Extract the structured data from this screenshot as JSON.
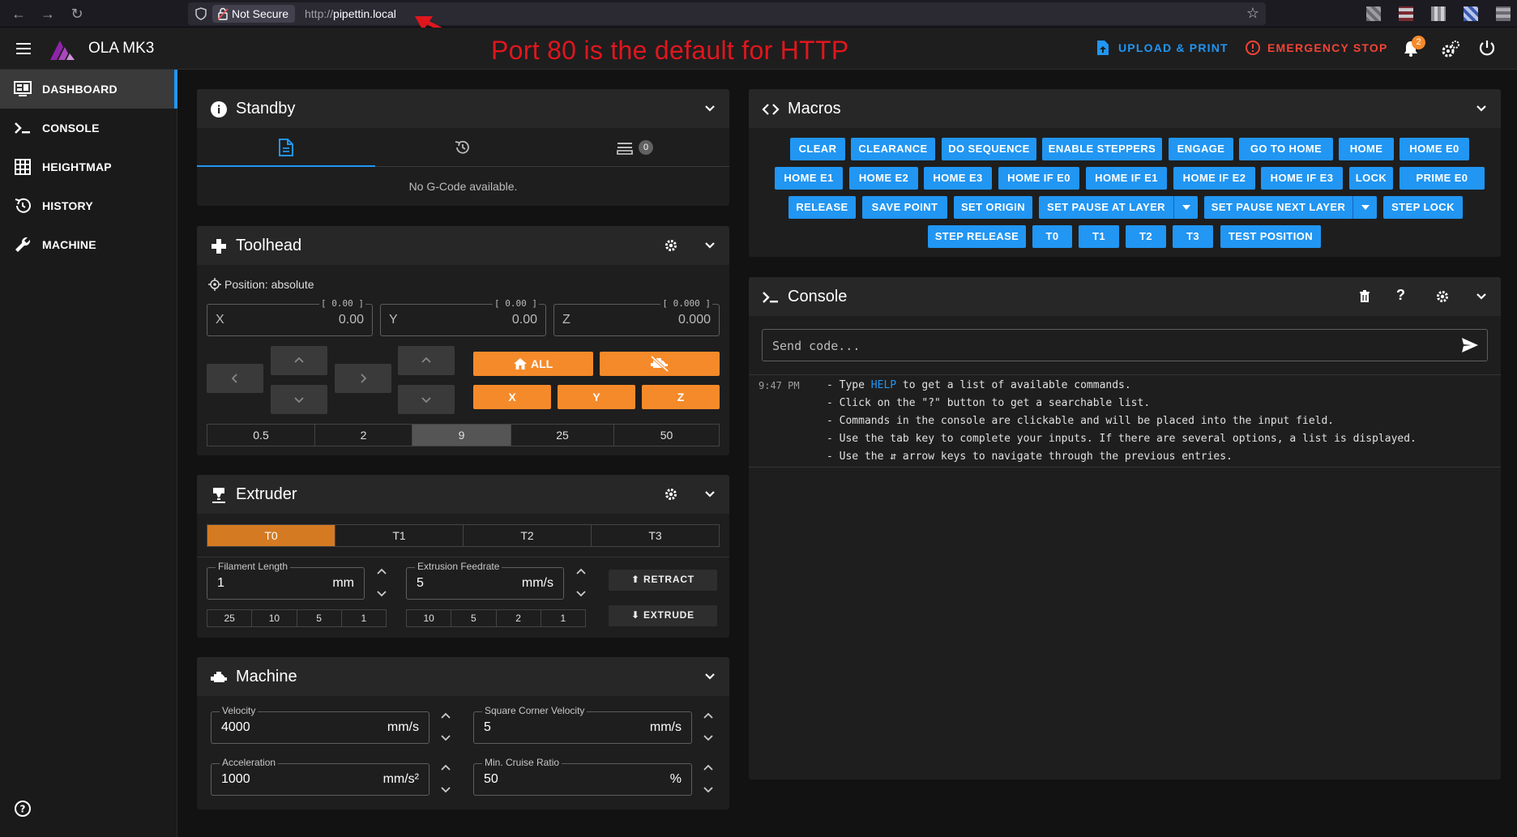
{
  "browser": {
    "not_secure": "Not Secure",
    "url_protocol": "http://",
    "url_host": "pipettin.local"
  },
  "annotation": "Port 80 is the default for HTTP",
  "appbar": {
    "title": "OLA MK3",
    "upload_print": "UPLOAD & PRINT",
    "emergency_stop": "EMERGENCY STOP",
    "notification_count": "2"
  },
  "sidebar": {
    "items": [
      {
        "label": "DASHBOARD",
        "icon": "monitor-dashboard-icon",
        "active": true
      },
      {
        "label": "CONSOLE",
        "icon": "console-icon"
      },
      {
        "label": "HEIGHTMAP",
        "icon": "grid-icon"
      },
      {
        "label": "HISTORY",
        "icon": "history-icon"
      },
      {
        "label": "MACHINE",
        "icon": "wrench-icon"
      }
    ]
  },
  "standby": {
    "title": "Standby",
    "queue_count": "0",
    "empty_text": "No G-Code available."
  },
  "toolhead": {
    "title": "Toolhead",
    "position_mode": "Position: absolute",
    "axes": [
      {
        "label": "X",
        "value": "0.00",
        "hint": "[ 0.00 ]"
      },
      {
        "label": "Y",
        "value": "0.00",
        "hint": "[ 0.00 ]"
      },
      {
        "label": "Z",
        "value": "0.000",
        "hint": "[ 0.000 ]"
      }
    ],
    "home_all": "ALL",
    "home_x": "X",
    "home_y": "Y",
    "home_z": "Z",
    "steps": [
      "0.5",
      "2",
      "9",
      "25",
      "50"
    ],
    "active_step": "9"
  },
  "extruder": {
    "title": "Extruder",
    "tools": [
      "T0",
      "T1",
      "T2",
      "T3"
    ],
    "active_tool": "T0",
    "filament_length_label": "Filament Length",
    "filament_length_value": "1",
    "filament_length_unit": "mm",
    "feedrate_label": "Extrusion Feedrate",
    "feedrate_value": "5",
    "feedrate_unit": "mm/s",
    "length_presets": [
      "25",
      "10",
      "5",
      "1"
    ],
    "feedrate_presets": [
      "10",
      "5",
      "2",
      "1"
    ],
    "retract": "RETRACT",
    "extrude": "EXTRUDE"
  },
  "machine": {
    "title": "Machine",
    "velocity_label": "Velocity",
    "velocity_value": "4000",
    "velocity_unit": "mm/s",
    "scv_label": "Square Corner Velocity",
    "scv_value": "5",
    "scv_unit": "mm/s",
    "accel_label": "Acceleration",
    "accel_value": "1000",
    "accel_unit": "mm/s²",
    "cruise_label": "Min. Cruise Ratio",
    "cruise_value": "50",
    "cruise_unit": "%"
  },
  "macros": {
    "title": "Macros",
    "buttons": [
      "CLEAR",
      "CLEARANCE",
      "DO SEQUENCE",
      "ENABLE STEPPERS",
      "ENGAGE",
      "GO TO HOME",
      "HOME",
      "HOME E0",
      "HOME E1",
      "HOME E2",
      "HOME E3",
      "HOME IF E0",
      "HOME IF E1",
      "HOME IF E2",
      "HOME IF E3",
      "LOCK",
      "PRIME E0",
      "RELEASE",
      "SAVE POINT",
      "SET ORIGIN",
      "SET PAUSE AT LAYER",
      "SET PAUSE NEXT LAYER",
      "STEP LOCK",
      "STEP RELEASE",
      "T0",
      "T1",
      "T2",
      "T3",
      "TEST POSITION"
    ]
  },
  "console": {
    "title": "Console",
    "placeholder": "Send code...",
    "time": "9:47 PM",
    "lines": [
      {
        "pre": "- Type ",
        "link": "HELP",
        "post": " to get a list of available commands."
      },
      {
        "pre": "- Click on the \"?\" button to get a searchable list."
      },
      {
        "pre": "- Commands in the console are clickable and will be placed into the input field."
      },
      {
        "pre": "- Use the tab key to complete your inputs. If there are several options, a list is displayed."
      },
      {
        "pre": "- Use the ⇵ arrow keys to navigate through the previous entries."
      }
    ]
  },
  "colors": {
    "accent": "#2196f3",
    "orange": "#f58a2a",
    "danger": "#f44336",
    "annotation": "#e0161d"
  }
}
